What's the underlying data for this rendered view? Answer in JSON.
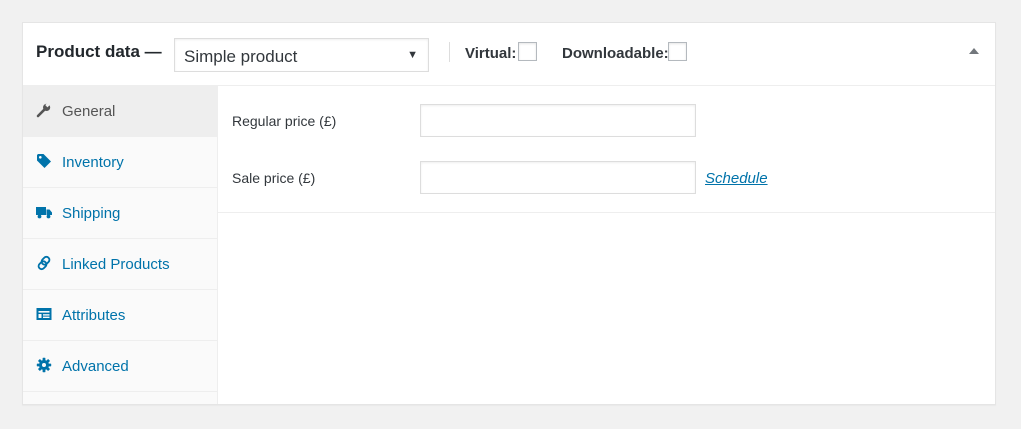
{
  "header": {
    "title": "Product data —",
    "product_type": {
      "selected": "Simple product",
      "arrow": "▼"
    },
    "virtual_label": "Virtual:",
    "downloadable_label": "Downloadable:",
    "virtual_checked": false,
    "downloadable_checked": false
  },
  "tabs": [
    {
      "label": "General",
      "icon": "wrench-icon",
      "active": true
    },
    {
      "label": "Inventory",
      "icon": "tag-icon",
      "active": false
    },
    {
      "label": "Shipping",
      "icon": "truck-icon",
      "active": false
    },
    {
      "label": "Linked Products",
      "icon": "link-icon",
      "active": false
    },
    {
      "label": "Attributes",
      "icon": "list-card-icon",
      "active": false
    },
    {
      "label": "Advanced",
      "icon": "gear-icon",
      "active": false
    }
  ],
  "general": {
    "regular_price_label": "Regular price (£)",
    "regular_price_value": "",
    "sale_price_label": "Sale price (£)",
    "sale_price_value": "",
    "schedule_link": "Schedule"
  },
  "colors": {
    "link": "#0073aa",
    "active_tab_bg": "#eeeeee",
    "sidebar_bg": "#fafafa"
  }
}
